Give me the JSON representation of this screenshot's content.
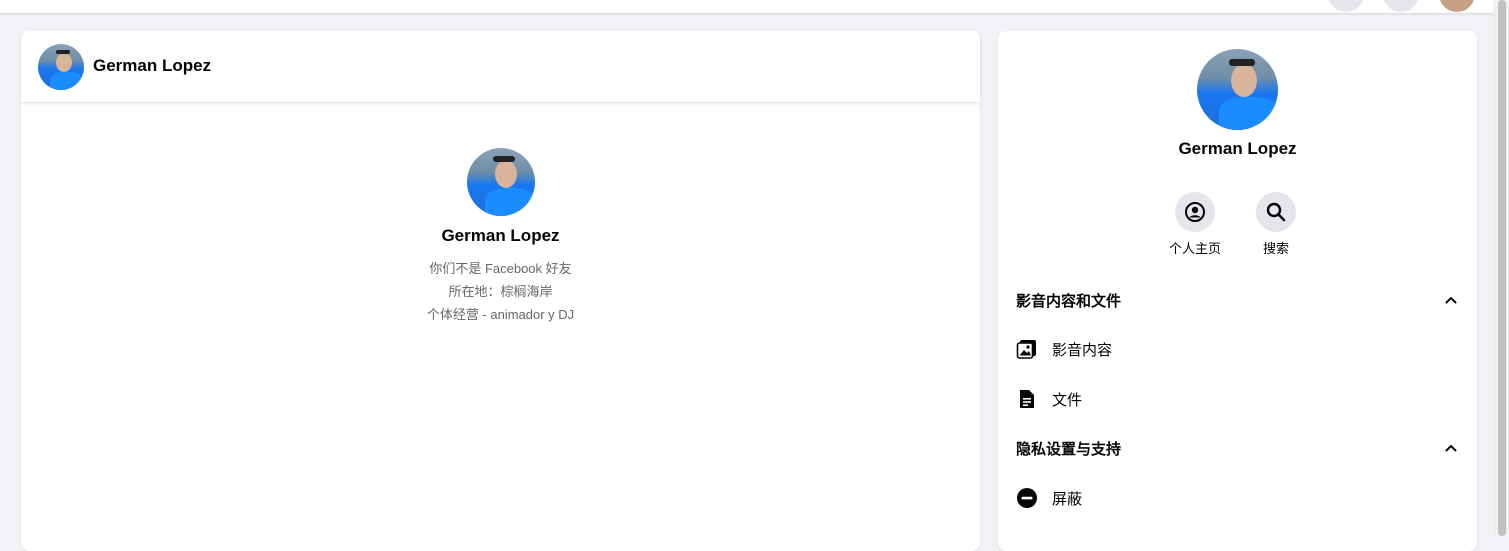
{
  "chat_header": {
    "name": "German Lopez"
  },
  "profile_card": {
    "name": "German Lopez",
    "friend_status": "你们不是 Facebook 好友",
    "location": "所在地：棕榈海岸",
    "work": "个体经营 - animador y DJ"
  },
  "side_panel": {
    "name": "German Lopez",
    "actions": [
      {
        "label": "个人主页",
        "icon": "user-circle-icon"
      },
      {
        "label": "搜索",
        "icon": "search-icon"
      }
    ],
    "sections": [
      {
        "title": "影音内容和文件",
        "items": [
          {
            "label": "影音内容",
            "icon": "image-icon"
          },
          {
            "label": "文件",
            "icon": "file-icon"
          }
        ]
      },
      {
        "title": "隐私设置与支持",
        "items": [
          {
            "label": "屏蔽",
            "icon": "block-icon"
          }
        ]
      }
    ]
  }
}
